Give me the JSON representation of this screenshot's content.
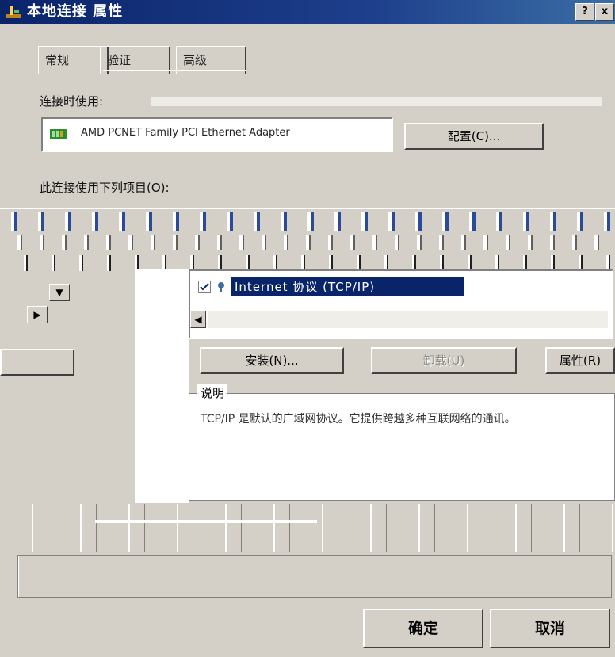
{
  "window": {
    "title": "本地连接 属性",
    "help_button": "?",
    "close_button": "x"
  },
  "tabs": [
    "常规",
    "验证",
    "高级"
  ],
  "connect_using_label": "连接时使用:",
  "adapter": {
    "name": "AMD PCNET Family PCI Ethernet Adapter",
    "configure_button": "配置(C)..."
  },
  "items_label": "此连接使用下列项目(O):",
  "items_list": {
    "selected_item": "Internet 协议 (TCP/IP)"
  },
  "buttons": {
    "install": "安装(N)...",
    "uninstall": "卸载(U)",
    "properties": "属性(R)"
  },
  "description": {
    "group_label": "说明",
    "text": "TCP/IP 是默认的广域网协议。它提供跨越多种互联网络的通讯。"
  },
  "footer": {
    "ok": "确定",
    "cancel": "取消"
  }
}
